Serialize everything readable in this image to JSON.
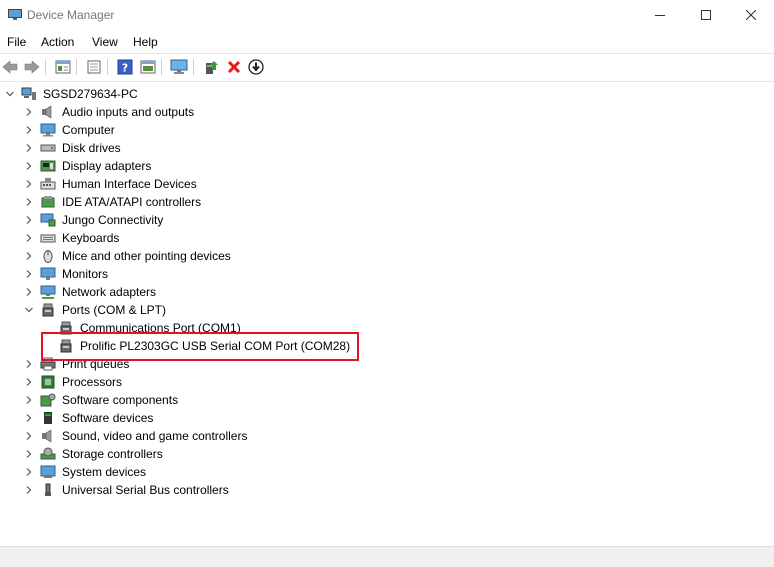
{
  "window": {
    "title": "Device Manager"
  },
  "menu": {
    "file": "File",
    "action": "Action",
    "view": "View",
    "help": "Help"
  },
  "toolbar": {
    "icons": [
      "back-icon",
      "forward-icon",
      "properties-icon",
      "update-view-icon",
      "help-icon",
      "driver-icon",
      "monitor-icon",
      "add-driver-icon",
      "uninstall-icon",
      "download-icon"
    ]
  },
  "tree": {
    "root": "SGSD279634-PC",
    "categories": [
      {
        "label": "Audio inputs and outputs",
        "icon": "speaker-icon",
        "expanded": false
      },
      {
        "label": "Computer",
        "icon": "computer-icon",
        "expanded": false
      },
      {
        "label": "Disk drives",
        "icon": "disk-drive-icon",
        "expanded": false
      },
      {
        "label": "Display adapters",
        "icon": "display-adapter-icon",
        "expanded": false
      },
      {
        "label": "Human Interface Devices",
        "icon": "hid-icon",
        "expanded": false
      },
      {
        "label": "IDE ATA/ATAPI controllers",
        "icon": "ide-controller-icon",
        "expanded": false
      },
      {
        "label": "Jungo Connectivity",
        "icon": "jungo-icon",
        "expanded": false
      },
      {
        "label": "Keyboards",
        "icon": "keyboard-icon",
        "expanded": false
      },
      {
        "label": "Mice and other pointing devices",
        "icon": "mouse-icon",
        "expanded": false
      },
      {
        "label": "Monitors",
        "icon": "monitor-icon",
        "expanded": false
      },
      {
        "label": "Network adapters",
        "icon": "network-adapter-icon",
        "expanded": false
      },
      {
        "label": "Ports (COM & LPT)",
        "icon": "port-icon",
        "expanded": true,
        "children": [
          {
            "label": "Communications Port (COM1)",
            "icon": "port-icon"
          },
          {
            "label": "Prolific PL2303GC USB Serial COM Port (COM28)",
            "icon": "port-icon",
            "highlighted": true
          }
        ]
      },
      {
        "label": "Print queues",
        "icon": "printer-icon",
        "expanded": false
      },
      {
        "label": "Processors",
        "icon": "processor-icon",
        "expanded": false
      },
      {
        "label": "Software components",
        "icon": "software-component-icon",
        "expanded": false
      },
      {
        "label": "Software devices",
        "icon": "software-device-icon",
        "expanded": false
      },
      {
        "label": "Sound, video and game controllers",
        "icon": "sound-icon",
        "expanded": false
      },
      {
        "label": "Storage controllers",
        "icon": "storage-controller-icon",
        "expanded": false
      },
      {
        "label": "System devices",
        "icon": "system-device-icon",
        "expanded": false
      },
      {
        "label": "Universal Serial Bus controllers",
        "icon": "usb-icon",
        "expanded": false
      }
    ]
  },
  "colors": {
    "highlight_border": "#e81123",
    "accent": "#1e6fd9"
  }
}
